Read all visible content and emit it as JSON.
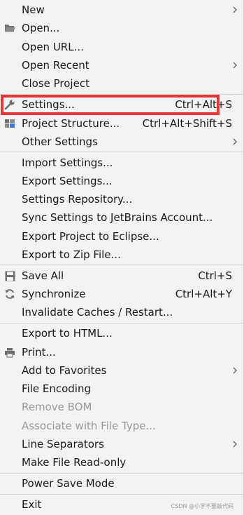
{
  "menu": {
    "items": [
      {
        "label": "New",
        "shortcut": "",
        "submenu": true,
        "icon": "",
        "disabled": false
      },
      {
        "label": "Open...",
        "shortcut": "",
        "submenu": false,
        "icon": "folder-icon",
        "disabled": false
      },
      {
        "label": "Open URL...",
        "shortcut": "",
        "submenu": false,
        "icon": "",
        "disabled": false
      },
      {
        "label": "Open Recent",
        "shortcut": "",
        "submenu": true,
        "icon": "",
        "disabled": false
      },
      {
        "label": "Close Project",
        "shortcut": "",
        "submenu": false,
        "icon": "",
        "disabled": false
      },
      {
        "label": "Settings...",
        "shortcut": "Ctrl+Alt+S",
        "submenu": false,
        "icon": "wrench-icon",
        "disabled": false
      },
      {
        "label": "Project Structure...",
        "shortcut": "Ctrl+Alt+Shift+S",
        "submenu": false,
        "icon": "project-structure-icon",
        "disabled": false
      },
      {
        "label": "Other Settings",
        "shortcut": "",
        "submenu": true,
        "icon": "",
        "disabled": false
      },
      {
        "label": "Import Settings...",
        "shortcut": "",
        "submenu": false,
        "icon": "",
        "disabled": false
      },
      {
        "label": "Export Settings...",
        "shortcut": "",
        "submenu": false,
        "icon": "",
        "disabled": false
      },
      {
        "label": "Settings Repository...",
        "shortcut": "",
        "submenu": false,
        "icon": "",
        "disabled": false
      },
      {
        "label": "Sync Settings to JetBrains Account...",
        "shortcut": "",
        "submenu": false,
        "icon": "",
        "disabled": false
      },
      {
        "label": "Export Project to Eclipse...",
        "shortcut": "",
        "submenu": false,
        "icon": "",
        "disabled": false
      },
      {
        "label": "Export to Zip File...",
        "shortcut": "",
        "submenu": false,
        "icon": "",
        "disabled": false
      },
      {
        "label": "Save All",
        "shortcut": "Ctrl+S",
        "submenu": false,
        "icon": "save-icon",
        "disabled": false
      },
      {
        "label": "Synchronize",
        "shortcut": "Ctrl+Alt+Y",
        "submenu": false,
        "icon": "sync-icon",
        "disabled": false
      },
      {
        "label": "Invalidate Caches / Restart...",
        "shortcut": "",
        "submenu": false,
        "icon": "",
        "disabled": false
      },
      {
        "label": "Export to HTML...",
        "shortcut": "",
        "submenu": false,
        "icon": "",
        "disabled": false
      },
      {
        "label": "Print...",
        "shortcut": "",
        "submenu": false,
        "icon": "printer-icon",
        "disabled": false
      },
      {
        "label": "Add to Favorites",
        "shortcut": "",
        "submenu": true,
        "icon": "",
        "disabled": false
      },
      {
        "label": "File Encoding",
        "shortcut": "",
        "submenu": false,
        "icon": "",
        "disabled": false
      },
      {
        "label": "Remove BOM",
        "shortcut": "",
        "submenu": false,
        "icon": "",
        "disabled": true
      },
      {
        "label": "Associate with File Type...",
        "shortcut": "",
        "submenu": false,
        "icon": "",
        "disabled": true
      },
      {
        "label": "Line Separators",
        "shortcut": "",
        "submenu": true,
        "icon": "",
        "disabled": false
      },
      {
        "label": "Make File Read-only",
        "shortcut": "",
        "submenu": false,
        "icon": "",
        "disabled": false
      },
      {
        "label": "Power Save Mode",
        "shortcut": "",
        "submenu": false,
        "icon": "",
        "disabled": false
      },
      {
        "label": "Exit",
        "shortcut": "",
        "submenu": false,
        "icon": "",
        "disabled": false
      }
    ]
  },
  "highlight": {
    "color": "#e8333a",
    "target": "Settings..."
  },
  "watermark": "CSDN @小学不要敲代码"
}
